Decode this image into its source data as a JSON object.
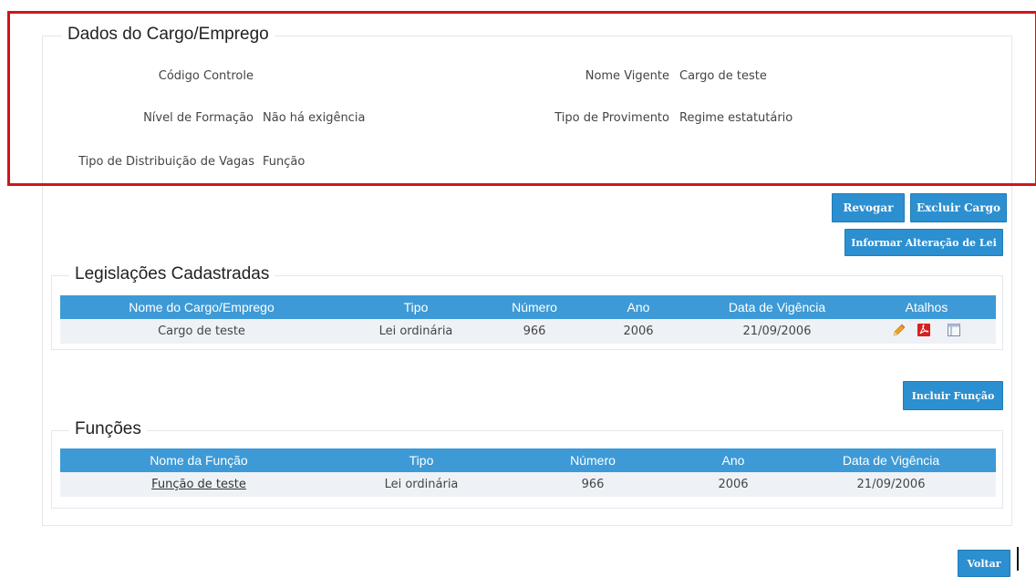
{
  "cargo": {
    "section_title": "Dados do Cargo/Emprego",
    "codigo_label": "Código Controle",
    "codigo_value": "",
    "nome_label": "Nome Vigente",
    "nome_value": "Cargo de teste",
    "nivel_label": "Nível de Formação",
    "nivel_value": "Não há exigência",
    "provimento_label": "Tipo de Provimento",
    "provimento_value": "Regime estatutário",
    "distribuicao_label": "Tipo de Distribuição de Vagas",
    "distribuicao_value": "Função"
  },
  "actions": {
    "revogar": "Revogar",
    "excluir": "Excluir Cargo",
    "informar": "Informar Alteração de Lei",
    "incluir_funcao": "Incluir Função",
    "voltar": "Voltar"
  },
  "legislacoes": {
    "section_title": "Legislações Cadastradas",
    "headers": [
      "Nome do Cargo/Emprego",
      "Tipo",
      "Número",
      "Ano",
      "Data de Vigência",
      "Atalhos"
    ],
    "rows": [
      [
        "Cargo de teste",
        "Lei ordinária",
        "966",
        "2006",
        "21/09/2006"
      ]
    ],
    "shortcut_icons": [
      "pencil-icon",
      "pdf-icon",
      "window-icon"
    ]
  },
  "funcoes": {
    "section_title": "Funções",
    "headers": [
      "Nome da Função",
      "Tipo",
      "Número",
      "Ano",
      "Data de Vigência"
    ],
    "rows": [
      [
        "Função de teste",
        "Lei ordinária",
        "966",
        "2006",
        "21/09/2006"
      ]
    ]
  },
  "colors": {
    "header_blue": "#3d9ad6",
    "button_blue": "#2c8fd0",
    "highlight_red": "#d0141b",
    "row_bg": "#eef2f7"
  }
}
